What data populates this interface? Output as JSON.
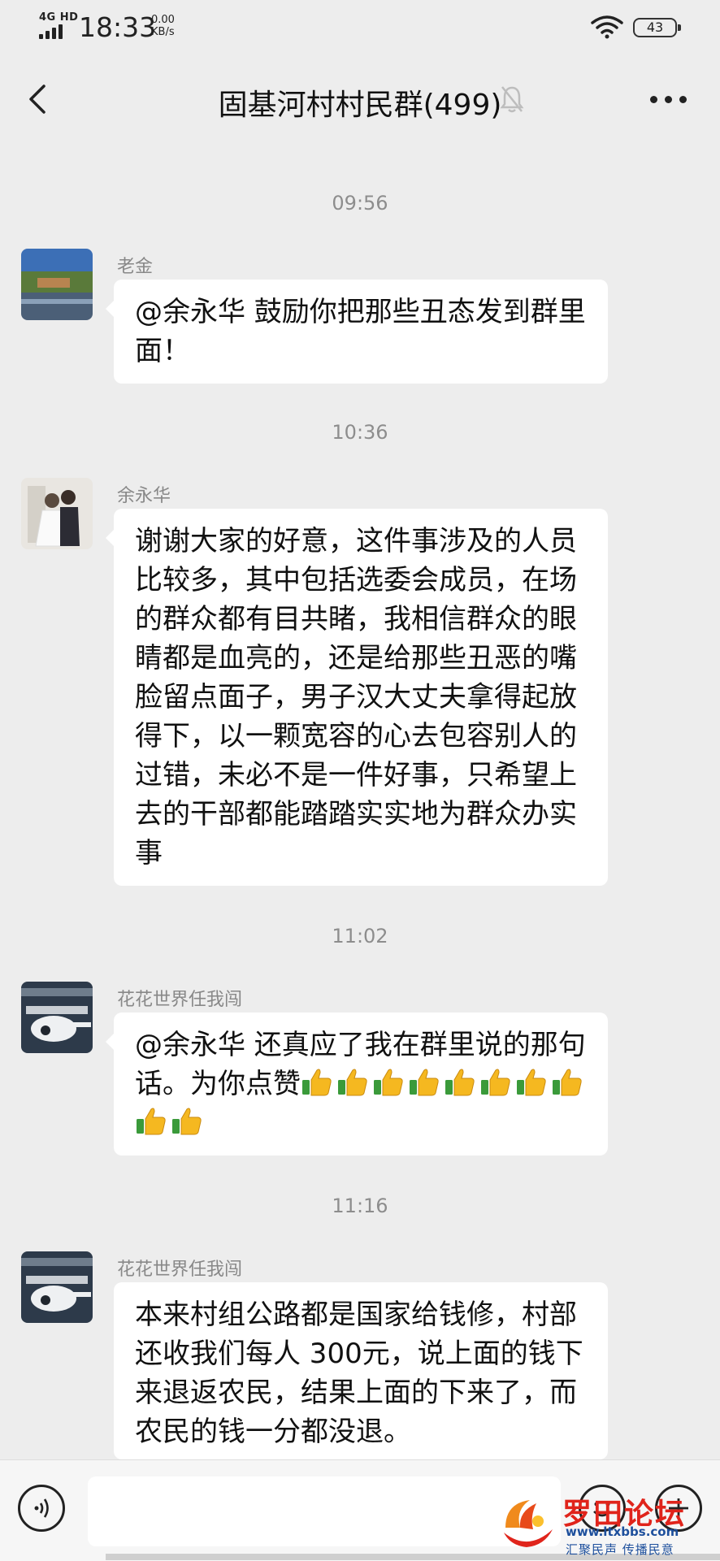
{
  "status_bar": {
    "network": "4G HD",
    "time": "18:33",
    "speed_value": "0.00",
    "speed_unit": "KB/s",
    "battery": "43",
    "icons": [
      "signal-icon",
      "wifi-icon",
      "battery-icon"
    ]
  },
  "header": {
    "title": "固基河村村民群(499)",
    "icons": [
      "back-icon",
      "mute-bell-icon",
      "more-icon"
    ]
  },
  "messages": [
    {
      "timestamp": "09:56",
      "sender": "老金",
      "text": "@余永华  鼓励你把那些丑态发到群里面！"
    },
    {
      "timestamp": "10:36",
      "sender": "余永华",
      "text": "谢谢大家的好意，这件事涉及的人员比较多，其中包括选委会成员，在场的群众都有目共睹，我相信群众的眼睛都是血亮的，还是给那些丑恶的嘴脸留点面子，男子汉大丈夫拿得起放得下，以一颗宽容的心去包容别人的过错，未必不是一件好事，只希望上去的干部都能踏踏实实地为群众办实事"
    },
    {
      "timestamp": "11:02",
      "sender": "花花世界任我闯",
      "text": "@余永华  还真应了我在群里说的那句话。为你点赞",
      "thumbs_count": 10
    },
    {
      "timestamp": "11:16",
      "sender": "花花世界任我闯",
      "text": "本来村组公路都是国家给钱修，村部还收我们每人 300元，说上面的钱下来退返农民，结果上面的下来了，而农民的钱一分都没退。"
    }
  ],
  "input_bar": {
    "placeholder": "",
    "icons": [
      "voice-icon",
      "emoji-icon",
      "plus-icon"
    ]
  },
  "watermark": {
    "title": "罗田论坛",
    "url": "www.ltxbbs.com",
    "slogan": "汇聚民声 传播民意"
  },
  "colors": {
    "background": "#ededed",
    "bubble": "#ffffff",
    "timestamp": "#8d8d8d",
    "watermark_red": "#e0241b",
    "watermark_blue": "#1d4f9c"
  }
}
